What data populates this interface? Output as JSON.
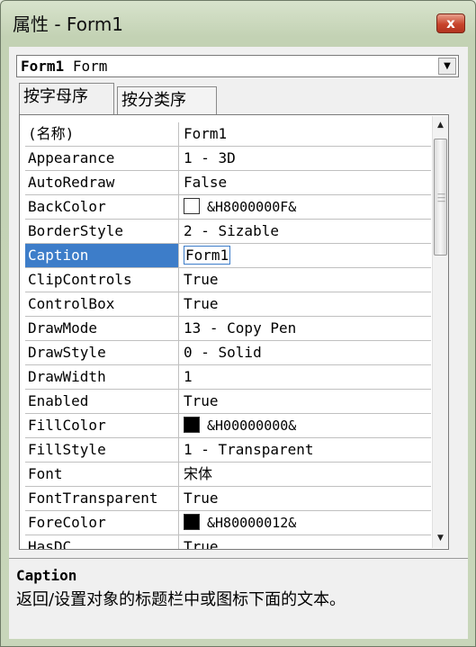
{
  "window": {
    "title": "属性 - Form1",
    "close_glyph": "x"
  },
  "object_selector": {
    "name": "Form1",
    "type": "Form"
  },
  "tabs": [
    {
      "label": "按字母序",
      "active": true
    },
    {
      "label": "按分类序",
      "active": false
    }
  ],
  "properties": [
    {
      "name": "(名称)",
      "value": "Form1"
    },
    {
      "name": "Appearance",
      "value": "1 - 3D"
    },
    {
      "name": "AutoRedraw",
      "value": "False"
    },
    {
      "name": "BackColor",
      "value": "&H8000000F&",
      "swatch": "#ffffff"
    },
    {
      "name": "BorderStyle",
      "value": "2 - Sizable"
    },
    {
      "name": "Caption",
      "value": "Form1",
      "selected": true
    },
    {
      "name": "ClipControls",
      "value": "True"
    },
    {
      "name": "ControlBox",
      "value": "True"
    },
    {
      "name": "DrawMode",
      "value": "13 - Copy Pen"
    },
    {
      "name": "DrawStyle",
      "value": "0 - Solid"
    },
    {
      "name": "DrawWidth",
      "value": "1"
    },
    {
      "name": "Enabled",
      "value": "True"
    },
    {
      "name": "FillColor",
      "value": "&H00000000&",
      "swatch": "#000000"
    },
    {
      "name": "FillStyle",
      "value": "1 - Transparent"
    },
    {
      "name": "Font",
      "value": "宋体"
    },
    {
      "name": "FontTransparent",
      "value": "True"
    },
    {
      "name": "ForeColor",
      "value": "&H80000012&",
      "swatch": "#000000"
    },
    {
      "name": "HasDC",
      "value": "True"
    }
  ],
  "description": {
    "title": "Caption",
    "text": "返回/设置对象的标题栏中或图标下面的文本。"
  },
  "colors": {
    "selection": "#3d7dc9",
    "close_button": "#c8442c"
  }
}
